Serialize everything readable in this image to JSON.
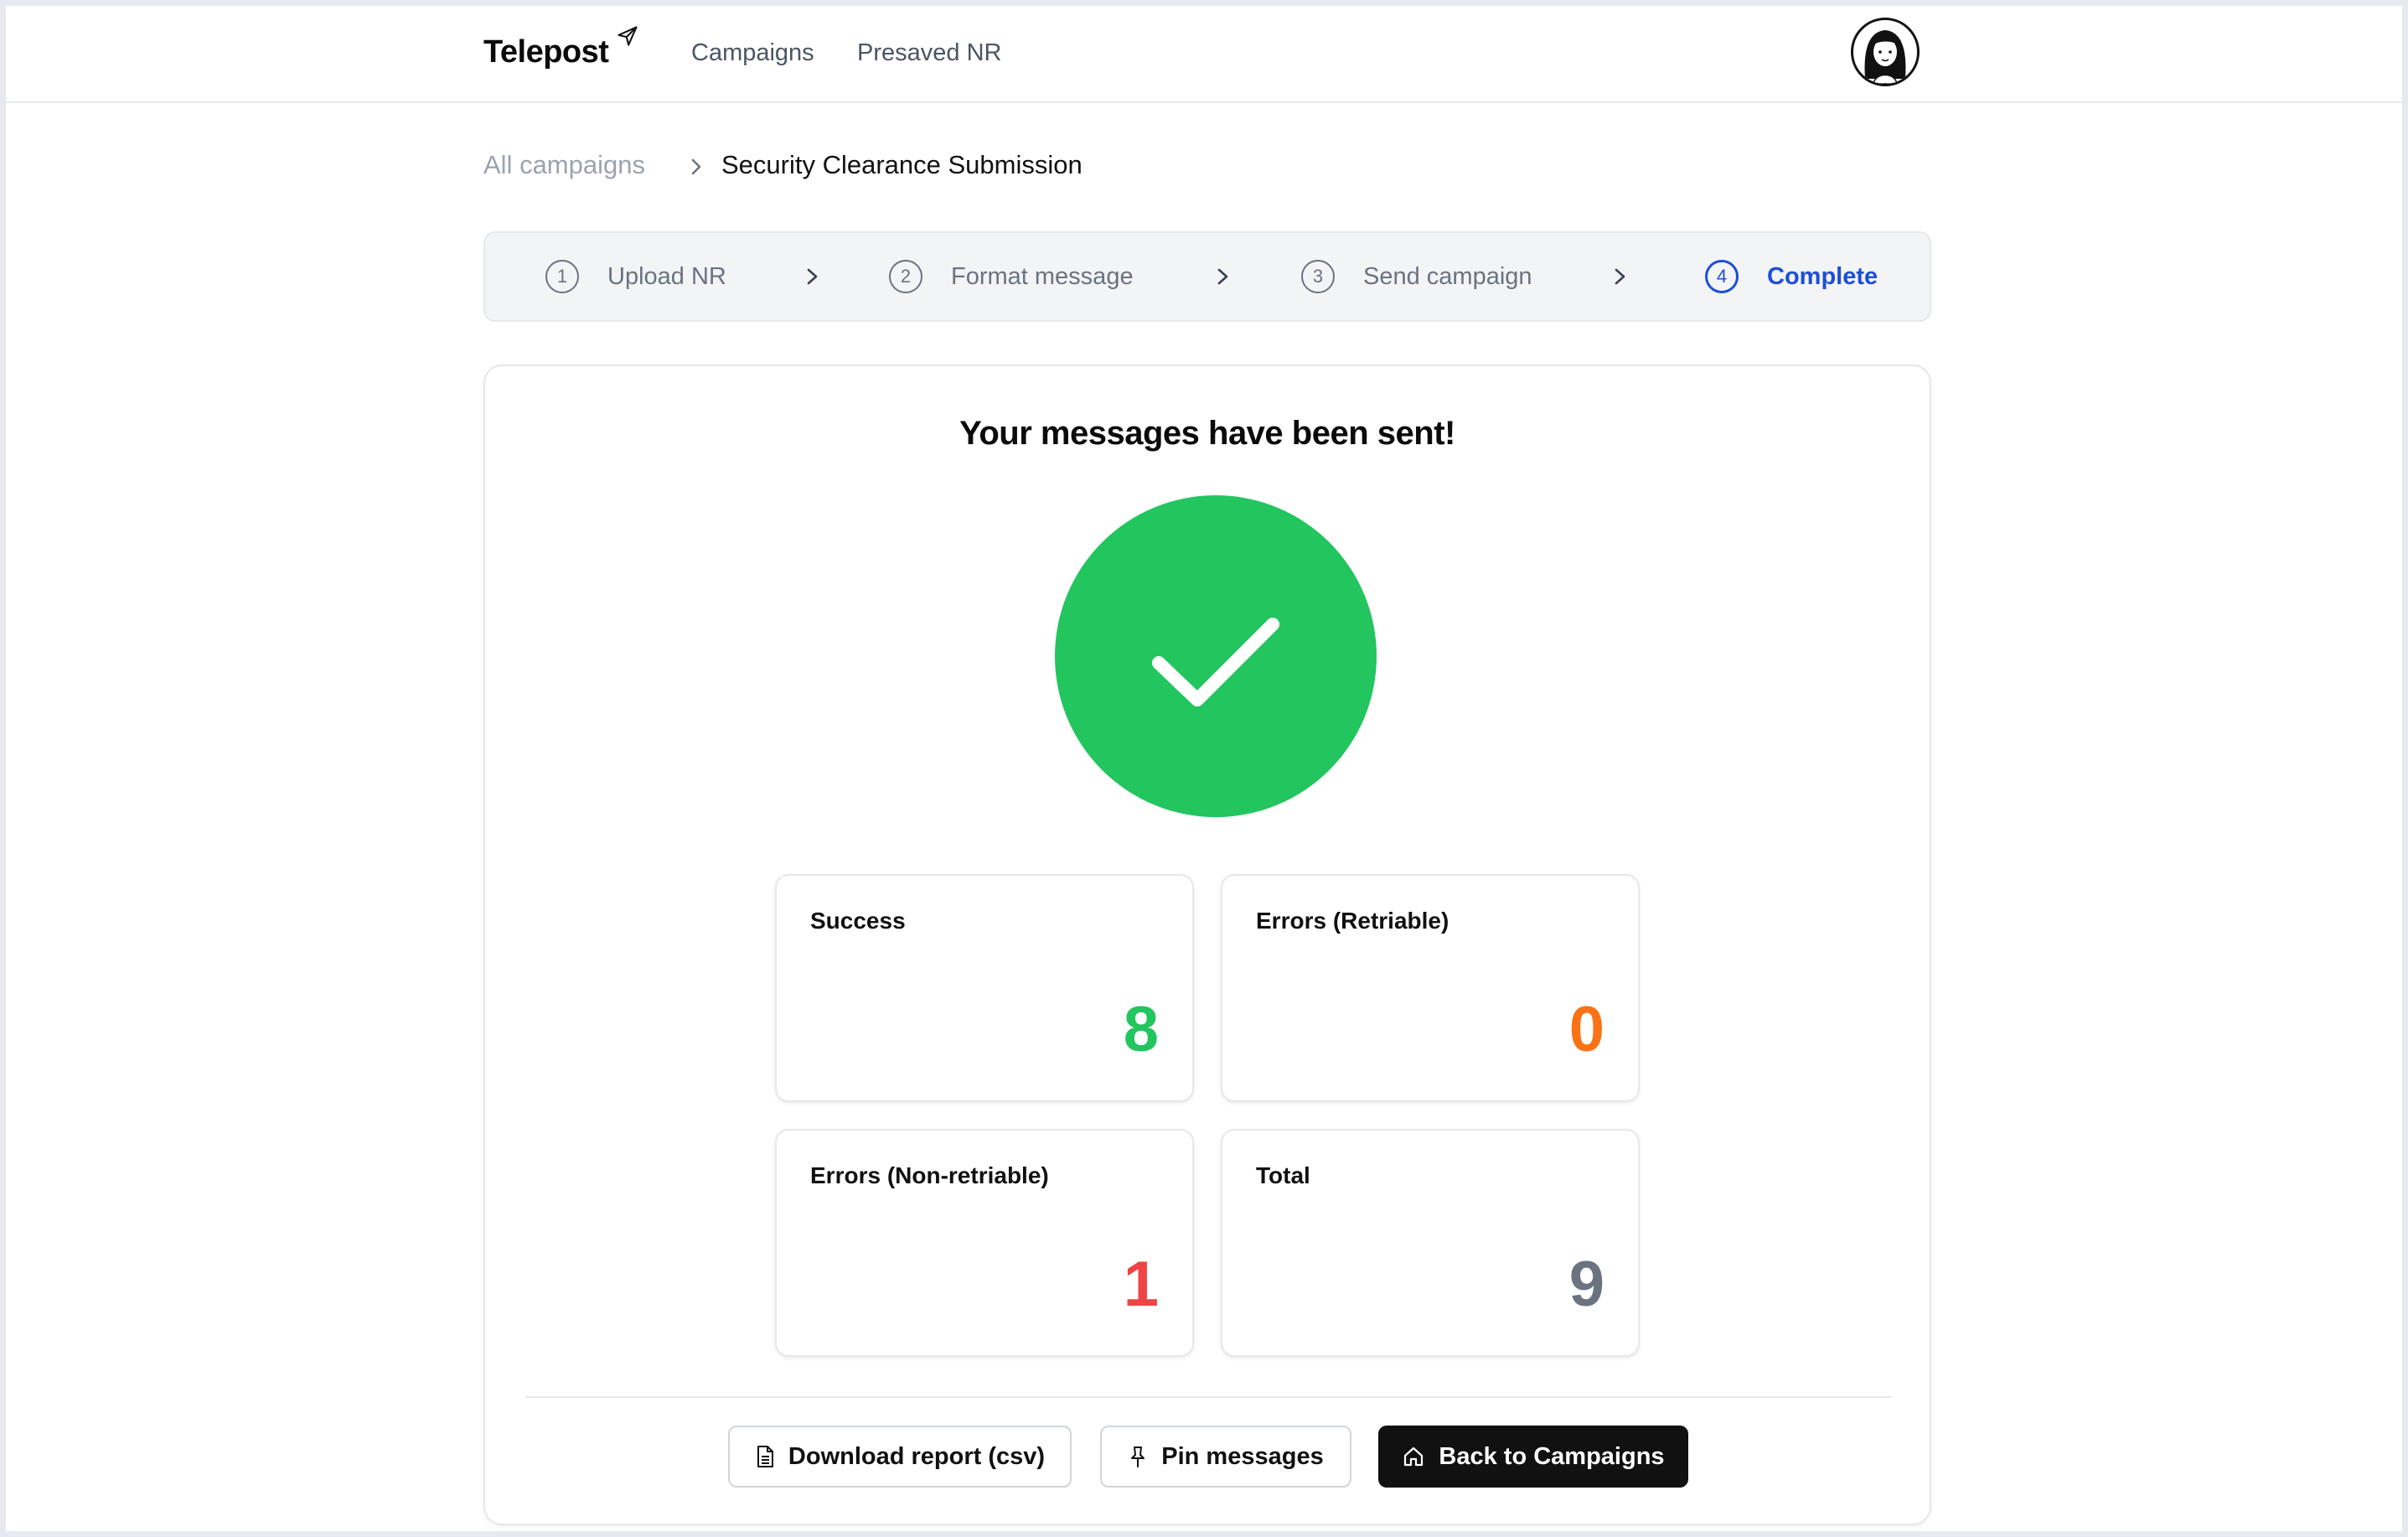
{
  "header": {
    "brand": "Telepost",
    "nav": [
      "Campaigns",
      "Presaved NR"
    ]
  },
  "breadcrumb": {
    "root": "All campaigns",
    "current": "Security Clearance Submission"
  },
  "stepper": {
    "steps": [
      {
        "num": "1",
        "label": "Upload NR"
      },
      {
        "num": "2",
        "label": "Format message"
      },
      {
        "num": "3",
        "label": "Send campaign"
      },
      {
        "num": "4",
        "label": "Complete"
      }
    ],
    "active_step": 4
  },
  "result": {
    "title": "Your messages have been sent!",
    "stats": [
      {
        "label": "Success",
        "value": "8",
        "color": "#22c55e"
      },
      {
        "label": "Errors (Retriable)",
        "value": "0",
        "color": "#f97316"
      },
      {
        "label": "Errors (Non-retriable)",
        "value": "1",
        "color": "#ef4444"
      },
      {
        "label": "Total",
        "value": "9",
        "color": "#6b7280"
      }
    ]
  },
  "actions": {
    "download": "Download report (csv)",
    "pin": "Pin messages",
    "back": "Back to Campaigns"
  },
  "colors": {
    "accent": "#1d4ed8",
    "success_circle": "#22c55e"
  },
  "icons": [
    "send-icon",
    "avatar",
    "chevron-right-icon",
    "checkmark-icon",
    "file-icon",
    "pin-icon",
    "home-icon"
  ]
}
